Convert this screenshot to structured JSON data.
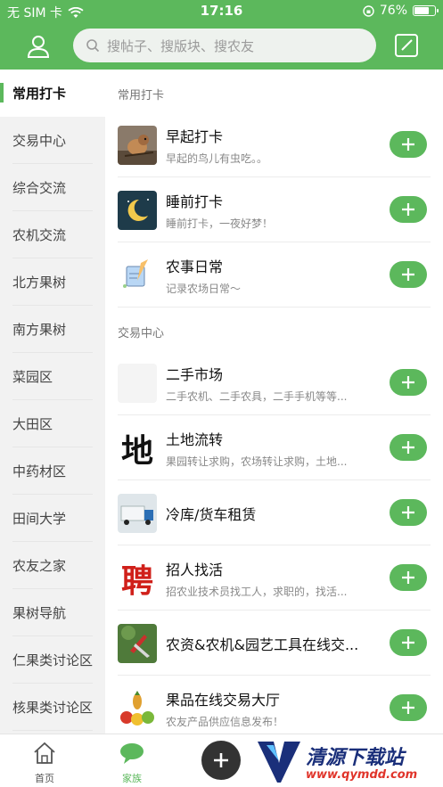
{
  "status_bar": {
    "carrier": "无 SIM 卡",
    "time": "17:16",
    "battery": "76%",
    "battery_level": 0.76
  },
  "search": {
    "placeholder": "搜帖子、搜版块、搜农友"
  },
  "sidebar": {
    "items": [
      {
        "label": "常用打卡",
        "active": true
      },
      {
        "label": "交易中心"
      },
      {
        "label": "综合交流"
      },
      {
        "label": "农机交流"
      },
      {
        "label": "北方果树"
      },
      {
        "label": "南方果树"
      },
      {
        "label": "菜园区"
      },
      {
        "label": "大田区"
      },
      {
        "label": "中药材区"
      },
      {
        "label": "田间大学"
      },
      {
        "label": "农友之家"
      },
      {
        "label": "果树导航"
      },
      {
        "label": "仁果类讨论区"
      },
      {
        "label": "核果类讨论区"
      }
    ]
  },
  "sections": [
    {
      "title": "常用打卡",
      "rows": [
        {
          "title": "早起打卡",
          "desc": "早起的鸟儿有虫吃。。",
          "icon": "bird-thumbnail"
        },
        {
          "title": "睡前打卡",
          "desc": "睡前打卡，一夜好梦！",
          "icon": "moon-thumbnail"
        },
        {
          "title": "农事日常",
          "desc": "记录农场日常～",
          "icon": "notebook-thumbnail"
        }
      ]
    },
    {
      "title": "交易中心",
      "rows": [
        {
          "title": "二手市场",
          "desc": "二手农机、二手农具，二手手机等等...",
          "icon": "blank-thumbnail"
        },
        {
          "title": "土地流转",
          "desc": "果园转让求购，农场转让求购，土地...",
          "icon": "calligraphy-thumbnail",
          "glyph": "地"
        },
        {
          "title": "冷库/货车租赁",
          "desc": "",
          "icon": "truck-thumbnail"
        },
        {
          "title": "招人找活",
          "desc": "招农业技术员找工人，求职的，找活...",
          "icon": "calligraphy-thumbnail",
          "glyph": "聘"
        },
        {
          "title": "农资&农机&园艺工具在线交...",
          "desc": "",
          "icon": "pruner-thumbnail"
        },
        {
          "title": "果品在线交易大厅",
          "desc": "农友产品供应信息发布！",
          "icon": "fruit-thumbnail"
        }
      ]
    }
  ],
  "tabbar": {
    "home_label": "首页",
    "family_label": "家族"
  },
  "watermark": {
    "text": "清源下载站",
    "sub": "www.qymdd.com"
  },
  "colors": {
    "accent": "#5cb85c",
    "sidebar_bg": "#f2f2f2",
    "fab": "#333333"
  }
}
